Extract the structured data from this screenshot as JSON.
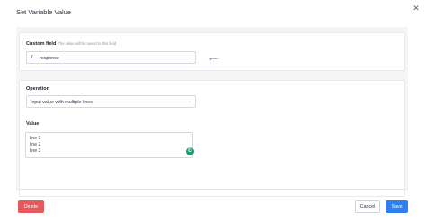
{
  "dialog": {
    "title": "Set Variable Value",
    "close_icon": "close-icon"
  },
  "custom_field": {
    "label": "Custom field",
    "hint": "The value will be saved to this field",
    "value": "response",
    "icon": "sigma-icon",
    "chevron_icon": "chevron-down-icon",
    "link_icon": "arrow-left-icon"
  },
  "operation": {
    "label": "Operation",
    "value": "Input value with multiple lines",
    "chevron_icon": "chevron-down-icon"
  },
  "value": {
    "label": "Value",
    "lines": [
      "line 1",
      "line 2",
      "line 3"
    ],
    "assistant_icon": "grammar-assistant-icon"
  },
  "footer": {
    "delete_label": "Delete",
    "cancel_label": "Cancel",
    "save_label": "Save"
  },
  "colors": {
    "delete": "#e35b5f",
    "save": "#2f7ff0",
    "accent": "#3b7bd9",
    "panel_bg": "#f4f5f7"
  }
}
